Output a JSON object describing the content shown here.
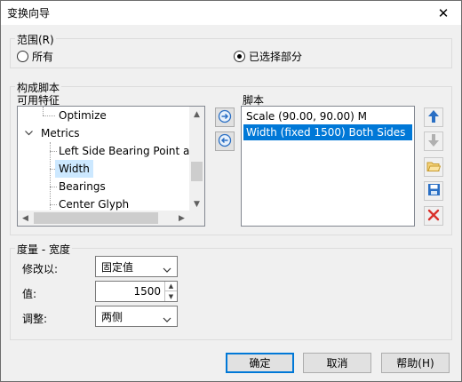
{
  "window": {
    "title": "变换向导",
    "close_glyph": "✕"
  },
  "range": {
    "title": "范围(R)",
    "options": [
      {
        "label": "所有",
        "checked": false
      },
      {
        "label": "已选择部分",
        "checked": true
      }
    ]
  },
  "compose": {
    "title": "构成脚本",
    "features_label": "可用特征",
    "script_label": "脚本",
    "tree_items": [
      {
        "label": "Optimize",
        "selected": false
      },
      {
        "label": "Metrics",
        "selected": false,
        "expand_glyph": "v"
      },
      {
        "label": "Left Side Bearing Point at",
        "selected": false
      },
      {
        "label": "Width",
        "selected": true
      },
      {
        "label": "Bearings",
        "selected": false
      },
      {
        "label": "Center Glyph",
        "selected": false
      }
    ],
    "script_items": [
      {
        "label": "Scale (90.00, 90.00) M",
        "selected": false
      },
      {
        "label": "Width (fixed 1500) Both Sides",
        "selected": true
      }
    ]
  },
  "metric": {
    "title": "度量 - 宽度",
    "modify_label": "修改以:",
    "modify_value": "固定值",
    "value_label": "值:",
    "value": "1500",
    "adjust_label": "调整:",
    "adjust_value": "两侧"
  },
  "buttons": {
    "ok": "确定",
    "cancel": "取消",
    "help": "帮助(H)"
  },
  "colors": {
    "selection": "#0078d7",
    "tree_selection": "#cce8ff",
    "arrow_blue": "#2a6fc4",
    "delete_red": "#d9312b"
  }
}
